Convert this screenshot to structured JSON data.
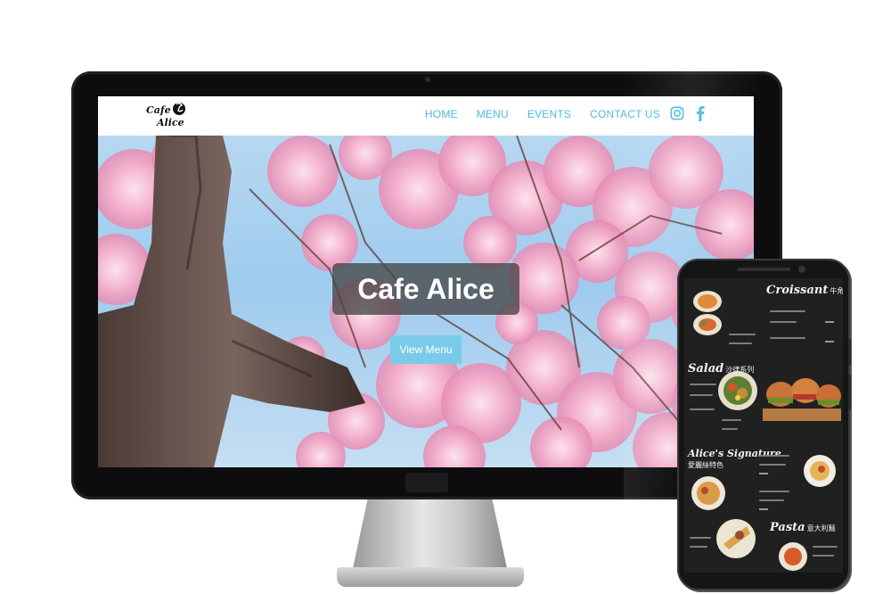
{
  "site": {
    "logo_line1": "Cafe",
    "logo_line2": "Alice",
    "nav": [
      "HOME",
      "MENU",
      "EVENTS",
      "CONTACT US"
    ],
    "social_icons": [
      "instagram-icon",
      "facebook-icon"
    ],
    "accent_color": "#4fb8e0",
    "hero": {
      "title": "Cafe Alice",
      "button_label": "View Menu",
      "button_color": "#79cbe9"
    }
  },
  "phone_menu": {
    "sections": [
      {
        "title": "Croissant",
        "subtitle": "牛角包"
      },
      {
        "title": "Salad",
        "subtitle": "沙律系列"
      },
      {
        "title": "Alice's Signature",
        "subtitle": "愛麗絲特色"
      },
      {
        "title": "Pasta",
        "subtitle": "意大利麵"
      }
    ]
  }
}
